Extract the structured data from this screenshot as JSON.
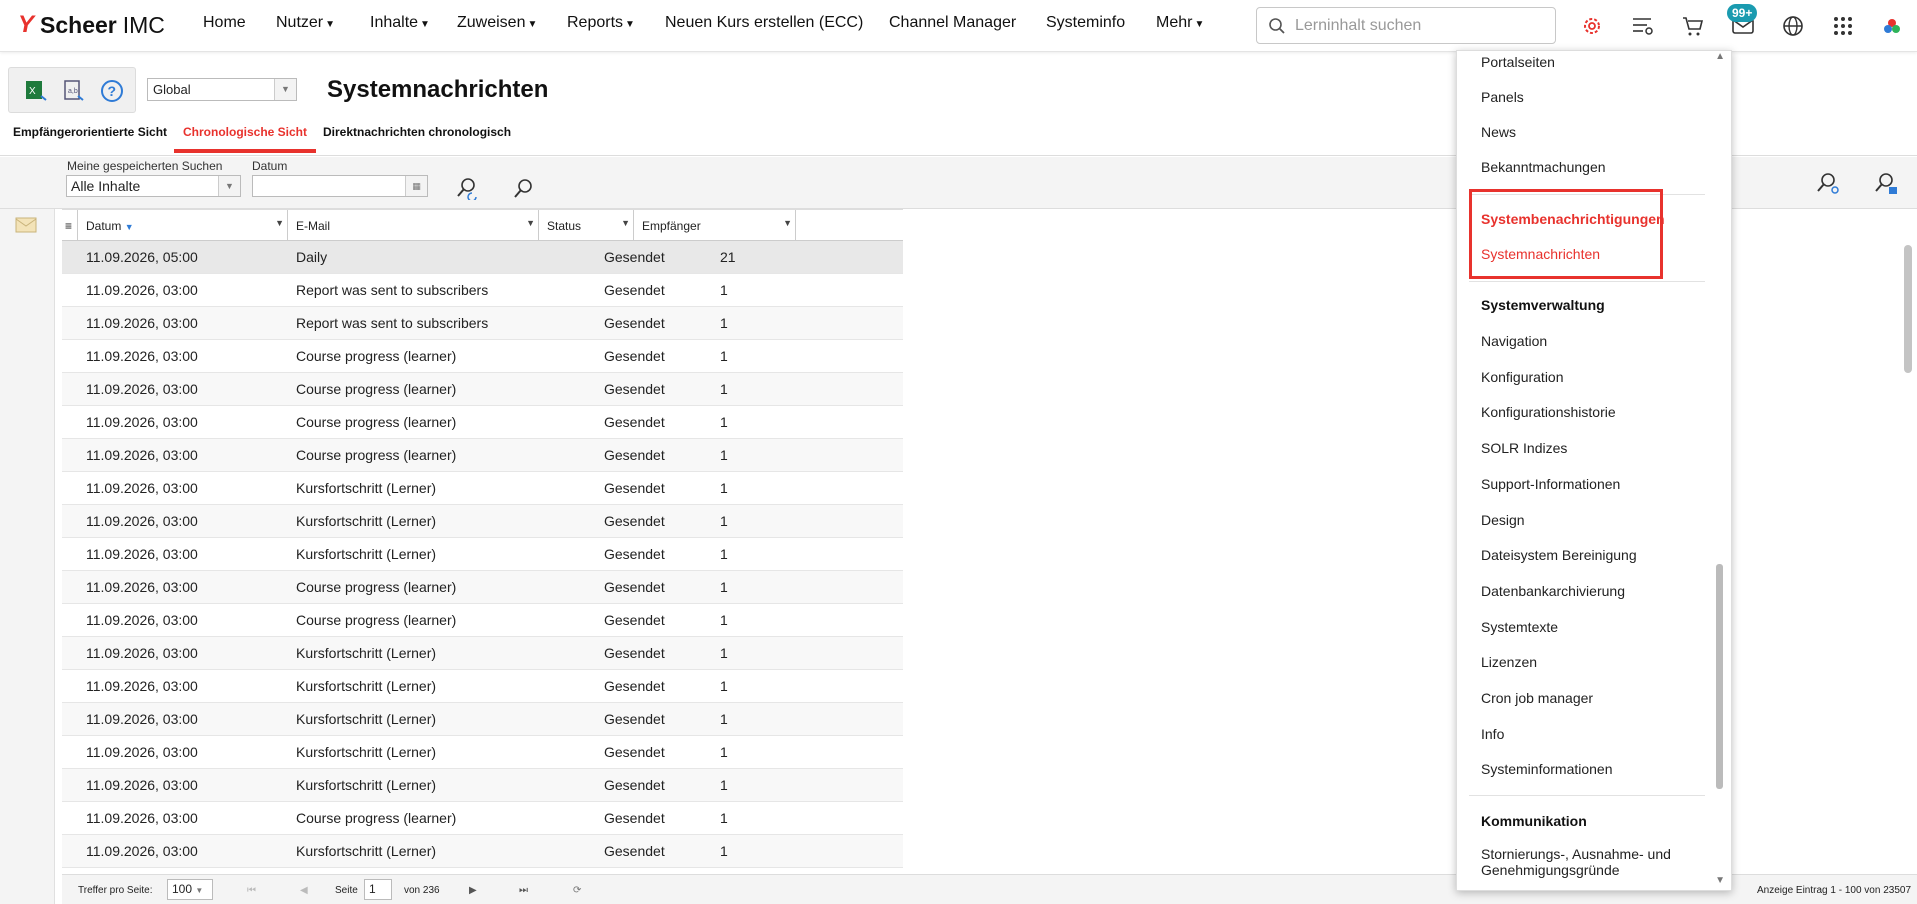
{
  "app": {
    "logo_brand": "Scheer",
    "logo_product": "IMC"
  },
  "nav": {
    "items": [
      {
        "label": "Home"
      },
      {
        "label": "Nutzer"
      },
      {
        "label": "Inhalte"
      },
      {
        "label": "Zuweisen"
      },
      {
        "label": "Reports"
      },
      {
        "label": "Neuen Kurs erstellen (ECC)"
      },
      {
        "label": "Channel Manager"
      },
      {
        "label": "Systeminfo"
      },
      {
        "label": "Mehr"
      }
    ],
    "search_placeholder": "Lerninhalt suchen",
    "badge": "99+"
  },
  "header": {
    "scope_value": "Global",
    "title": "Systemnachrichten"
  },
  "tabs": [
    {
      "label": "Empfängerorientierte Sicht"
    },
    {
      "label": "Chronologische Sicht"
    },
    {
      "label": "Direktnachrichten chronologisch"
    }
  ],
  "filters": {
    "saved_search_label": "Meine gespeicherten Suchen",
    "saved_search_value": "Alle Inhalte",
    "date_label": "Datum"
  },
  "grid": {
    "columns": [
      "Datum",
      "E-Mail",
      "Status",
      "Empfänger"
    ],
    "rows": [
      [
        "11.09.2026, 05:00",
        "Daily",
        "Gesendet",
        "21"
      ],
      [
        "11.09.2026, 03:00",
        "Report was sent to subscribers",
        "Gesendet",
        "1"
      ],
      [
        "11.09.2026, 03:00",
        "Report was sent to subscribers",
        "Gesendet",
        "1"
      ],
      [
        "11.09.2026, 03:00",
        "Course progress (learner)",
        "Gesendet",
        "1"
      ],
      [
        "11.09.2026, 03:00",
        "Course progress (learner)",
        "Gesendet",
        "1"
      ],
      [
        "11.09.2026, 03:00",
        "Course progress (learner)",
        "Gesendet",
        "1"
      ],
      [
        "11.09.2026, 03:00",
        "Course progress (learner)",
        "Gesendet",
        "1"
      ],
      [
        "11.09.2026, 03:00",
        "Kursfortschritt (Lerner)",
        "Gesendet",
        "1"
      ],
      [
        "11.09.2026, 03:00",
        "Kursfortschritt (Lerner)",
        "Gesendet",
        "1"
      ],
      [
        "11.09.2026, 03:00",
        "Kursfortschritt (Lerner)",
        "Gesendet",
        "1"
      ],
      [
        "11.09.2026, 03:00",
        "Course progress (learner)",
        "Gesendet",
        "1"
      ],
      [
        "11.09.2026, 03:00",
        "Course progress (learner)",
        "Gesendet",
        "1"
      ],
      [
        "11.09.2026, 03:00",
        "Kursfortschritt (Lerner)",
        "Gesendet",
        "1"
      ],
      [
        "11.09.2026, 03:00",
        "Kursfortschritt (Lerner)",
        "Gesendet",
        "1"
      ],
      [
        "11.09.2026, 03:00",
        "Kursfortschritt (Lerner)",
        "Gesendet",
        "1"
      ],
      [
        "11.09.2026, 03:00",
        "Kursfortschritt (Lerner)",
        "Gesendet",
        "1"
      ],
      [
        "11.09.2026, 03:00",
        "Kursfortschritt (Lerner)",
        "Gesendet",
        "1"
      ],
      [
        "11.09.2026, 03:00",
        "Course progress (learner)",
        "Gesendet",
        "1"
      ],
      [
        "11.09.2026, 03:00",
        "Kursfortschritt (Lerner)",
        "Gesendet",
        "1"
      ]
    ]
  },
  "pager": {
    "per_page_label": "Treffer pro Seite:",
    "per_page_value": "100",
    "page_label": "Seite",
    "page_value": "1",
    "of_label": "von 236",
    "summary": "Anzeige Eintrag 1 - 100 von 23507"
  },
  "menu": {
    "items_top": [
      "Portalseiten",
      "Panels",
      "News",
      "Bekanntmachungen"
    ],
    "highlighted": [
      "Systembenachrichtigungen",
      "Systemnachrichten"
    ],
    "section_system": "Systemverwaltung",
    "system_items": [
      "Navigation",
      "Konfiguration",
      "Konfigurationshistorie",
      "SOLR Indizes",
      "Support-Informationen",
      "Design",
      "Dateisystem Bereinigung",
      "Datenbankarchivierung",
      "Systemtexte",
      "Lizenzen",
      "Cron job manager",
      "Info",
      "Systeminformationen"
    ],
    "section_comm": "Kommunikation",
    "comm_item_line1": "Stornierungs-, Ausnahme- und",
    "comm_item_line2": "Genehmigungsgründe"
  },
  "colors": {
    "accent": "#e8322d",
    "badge": "#1a9bb0"
  }
}
